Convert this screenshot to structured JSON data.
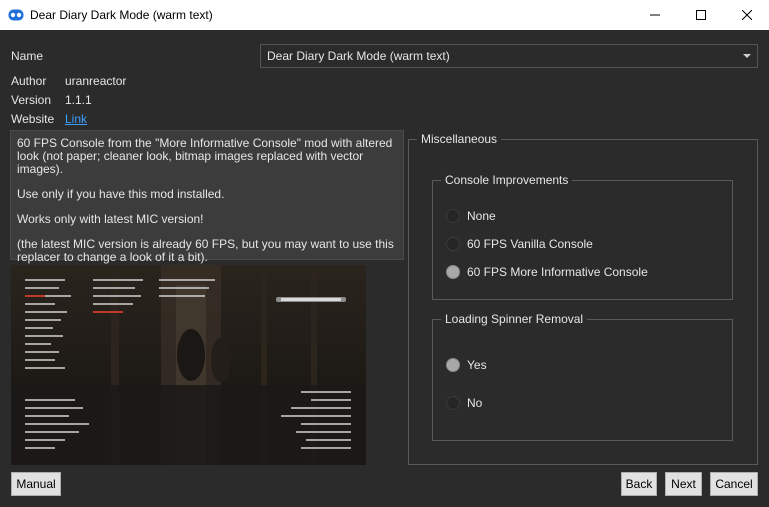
{
  "window": {
    "title": "Dear Diary Dark Mode (warm text)"
  },
  "form": {
    "name_label": "Name",
    "name_value": "Dear Diary Dark Mode (warm text)",
    "author_label": "Author",
    "author_value": "uranreactor",
    "version_label": "Version",
    "version_value": "1.1.1",
    "website_label": "Website",
    "website_link": "Link"
  },
  "description": [
    "60 FPS Console from the \"More Informative Console\" mod with altered look (not paper; cleaner look, bitmap images replaced with vector images).",
    "Use only if you have this mod installed.",
    "Works only with latest MIC version!",
    "(the latest MIC version is already 60 FPS, but you may want to use this replacer to change a look of it a bit)."
  ],
  "options": {
    "group_title": "Miscellaneous",
    "console": {
      "title": "Console Improvements",
      "items": [
        "None",
        "60 FPS Vanilla Console",
        "60 FPS More Informative Console"
      ],
      "selected": "60 FPS More Informative Console"
    },
    "spinner": {
      "title": "Loading Spinner Removal",
      "items": [
        "Yes",
        "No"
      ],
      "selected": "Yes"
    }
  },
  "buttons": {
    "manual": "Manual",
    "back": "Back",
    "next": "Next",
    "cancel": "Cancel"
  },
  "colors": {
    "background": "#2b2b2b",
    "panel": "#3c3c3c",
    "link": "#3aa0ff"
  }
}
